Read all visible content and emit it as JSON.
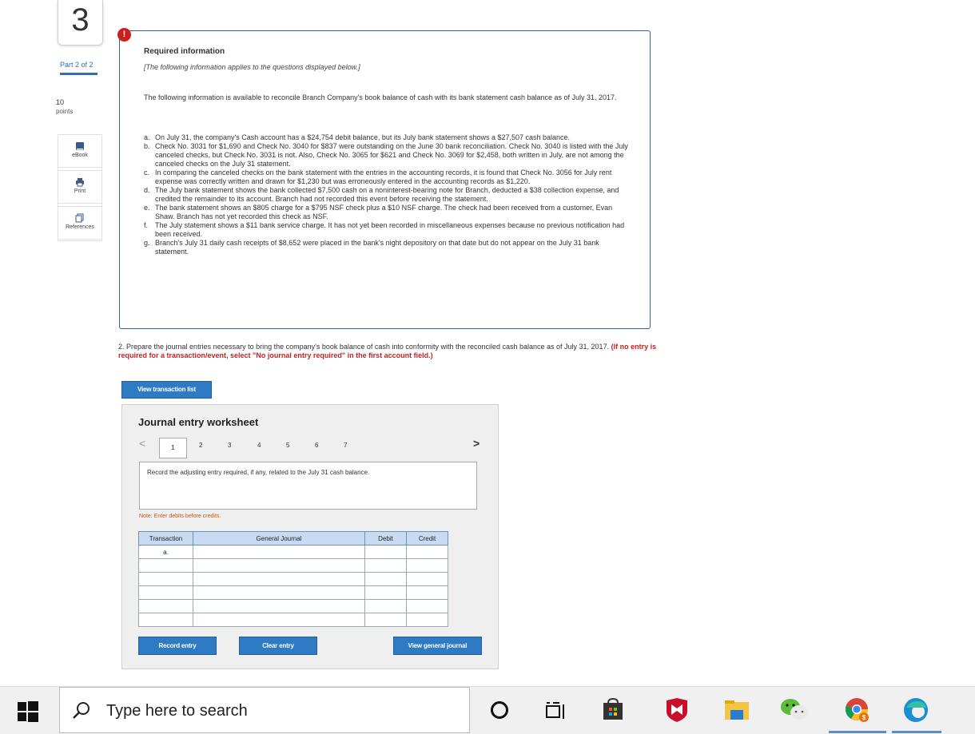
{
  "question": {
    "number": "3",
    "part": "Part 2 of 2",
    "points_value": "10",
    "points_label": "points"
  },
  "tools": {
    "ebook": "eBook",
    "print": "Print",
    "references": "References"
  },
  "info": {
    "alert": "!",
    "title": "Required information",
    "subtitle": "[The following information applies to the questions displayed below.]",
    "intro": "The following information is available to reconcile Branch Company's book balance of cash with its bank statement cash balance as of July 31, 2017.",
    "items": [
      {
        "letter": "a.",
        "text": "On July 31, the company's Cash account has a $24,754 debit balance, but its July bank statement shows a $27,507 cash balance."
      },
      {
        "letter": "b.",
        "text": "Check No. 3031 for $1,690 and Check No. 3040 for $837 were outstanding on the June 30 bank reconciliation. Check No. 3040 is listed with the July canceled checks, but Check No. 3031 is not. Also, Check No. 3065 for $621 and Check No. 3069 for $2,458, both written in July, are not among the canceled checks on the July 31 statement."
      },
      {
        "letter": "c.",
        "text": "In comparing the canceled checks on the bank statement with the entries in the accounting records, it is found that Check No. 3056 for July rent expense was correctly written and drawn for $1,230 but was erroneously entered in the accounting records as $1,220."
      },
      {
        "letter": "d.",
        "text": "The July bank statement shows the bank collected $7,500 cash on a noninterest-bearing note for Branch, deducted a $38 collection expense, and credited the remainder to its account. Branch had not recorded this event before receiving the statement."
      },
      {
        "letter": "e.",
        "text": "The bank statement shows an $805 charge for a $795 NSF check plus a $10 NSF charge. The check had been received from a customer, Evan Shaw. Branch has not yet recorded this check as NSF."
      },
      {
        "letter": "f.",
        "text": "The July statement shows a $11 bank service charge. It has not yet been recorded in miscellaneous expenses because no previous notification had been received."
      },
      {
        "letter": "g.",
        "text": "Branch's July 31 daily cash receipts of $8,652 were placed in the bank's night depository on that date but do not appear on the July 31 bank statement."
      }
    ]
  },
  "prompt": {
    "text": "2. Prepare the journal entries necessary to bring the company's book balance of cash into conformity with the reconciled cash balance as of July 31, 2017.",
    "instruction": "(If no entry is required for a transaction/event, select \"No journal entry required\" in the first account field.)"
  },
  "buttons": {
    "view_transaction_list": "View transaction list",
    "record_entry": "Record entry",
    "clear_entry": "Clear entry",
    "view_general_journal": "View general journal"
  },
  "worksheet": {
    "title": "Journal entry worksheet",
    "prev": "<",
    "next": ">",
    "pages": [
      "1",
      "2",
      "3",
      "4",
      "5",
      "6",
      "7"
    ],
    "record_text": "Record the adjusting entry required, if any, related to the July 31 cash balance.",
    "note": "Note: Enter debits before credits.",
    "columns": [
      "Transaction",
      "General Journal",
      "Debit",
      "Credit"
    ],
    "rows": [
      "a.",
      "",
      "",
      "",
      "",
      ""
    ]
  },
  "taskbar": {
    "search_placeholder": "Type here to search",
    "icons": [
      "windows-start-icon",
      "search-icon",
      "cortana-icon",
      "task-view-icon",
      "store-icon",
      "mcafee-icon",
      "file-explorer-icon",
      "wechat-icon",
      "chrome-icon",
      "edge-icon"
    ]
  }
}
